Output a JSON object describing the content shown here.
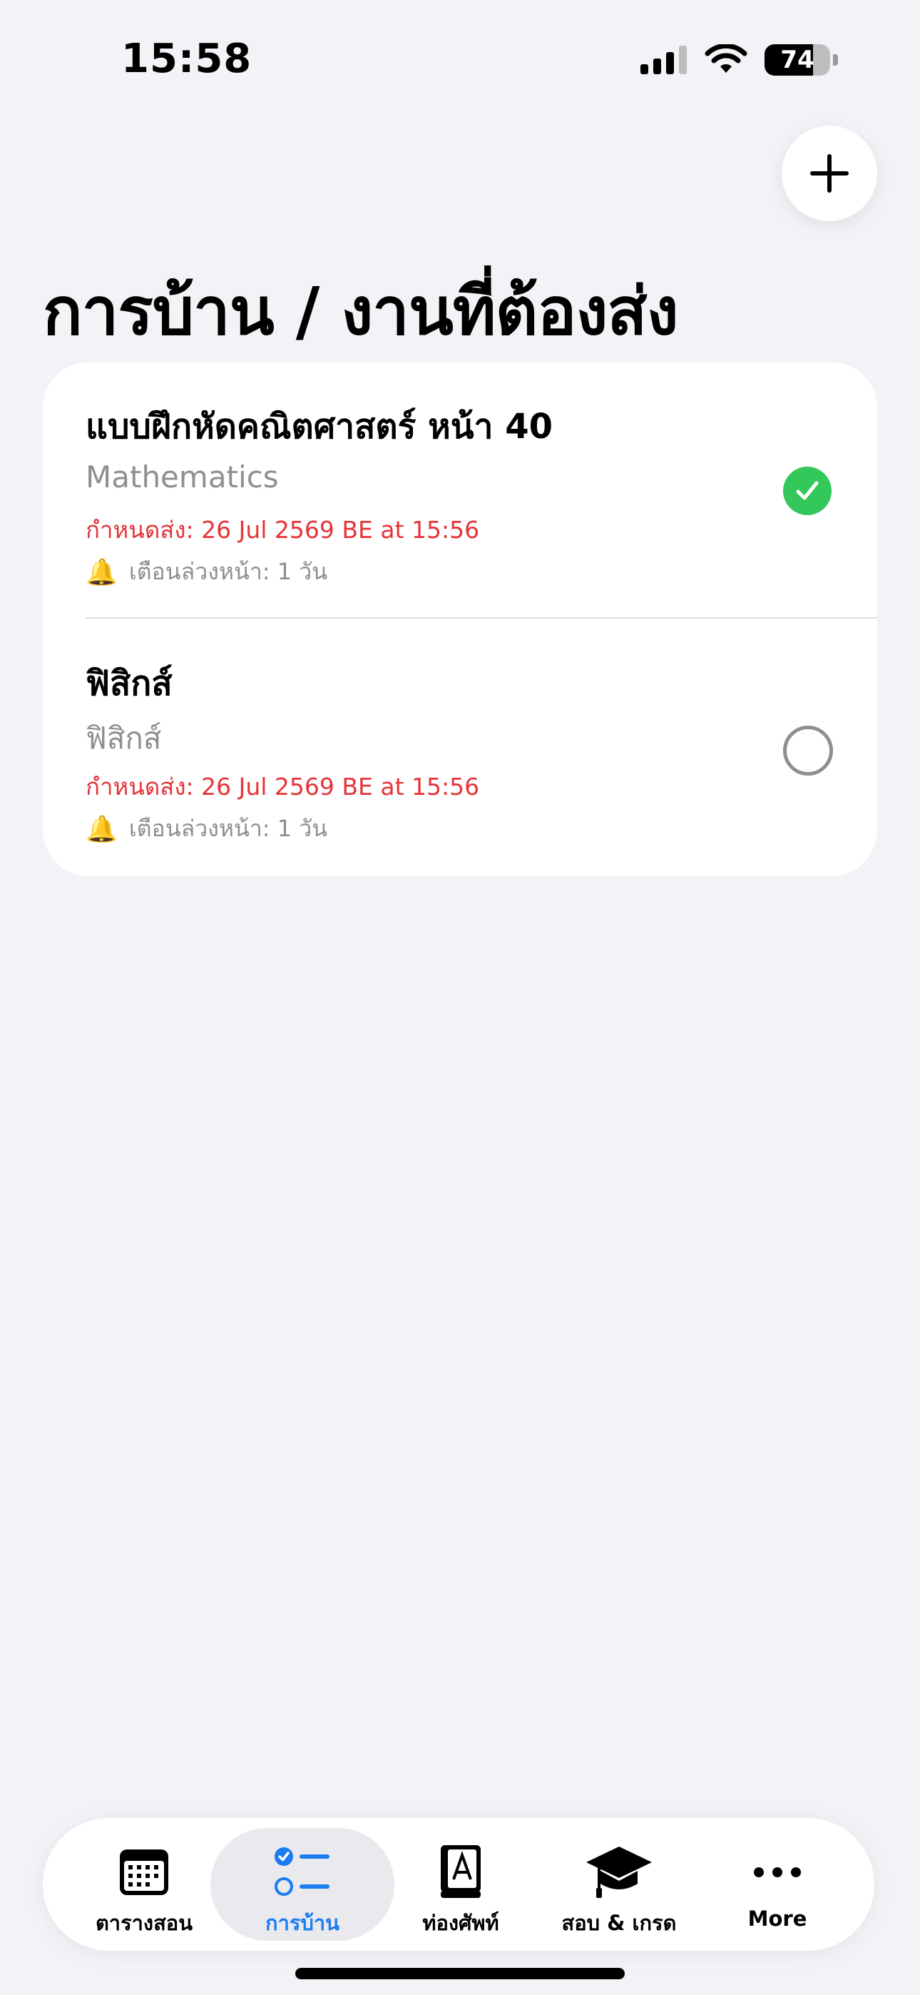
{
  "status": {
    "time": "15:58",
    "battery_percent": 74,
    "battery_label": "74",
    "icons": [
      "cellular-signal-icon",
      "wifi-icon",
      "battery-icon"
    ]
  },
  "page": {
    "title": "การบ้าน / งานที่ต้องส่ง",
    "add_icon": "plus-icon"
  },
  "homework": [
    {
      "title": "แบบฝึกหัดคณิตศาสตร์ หน้า 40",
      "subject": "Mathematics",
      "due": "กำหนดส่ง: 26 Jul 2569 BE at 15:56",
      "reminder": "เตือนล่วงหน้า: 1 วัน",
      "done": true
    },
    {
      "title": "ฟิสิกส์",
      "subject": "ฟิสิกส์",
      "due": "กำหนดส่ง: 26 Jul 2569 BE at 15:56",
      "reminder": "เตือนล่วงหน้า: 1 วัน",
      "done": false
    }
  ],
  "tabs": [
    {
      "label": "ตารางสอน",
      "icon": "calendar-icon",
      "active": false
    },
    {
      "label": "การบ้าน",
      "icon": "checklist-icon",
      "active": true
    },
    {
      "label": "ท่องศัพท์",
      "icon": "dictionary-icon",
      "active": false
    },
    {
      "label": "สอบ & เกรด",
      "icon": "graduation-cap-icon",
      "active": false
    },
    {
      "label": "More",
      "icon": "more-dots-icon",
      "active": false
    }
  ],
  "colors": {
    "background": "#f2f2f7",
    "accent": "#1a7cf2",
    "due_red": "#e5343a",
    "done_green": "#34c759",
    "secondary_gray": "#8e8e93"
  }
}
